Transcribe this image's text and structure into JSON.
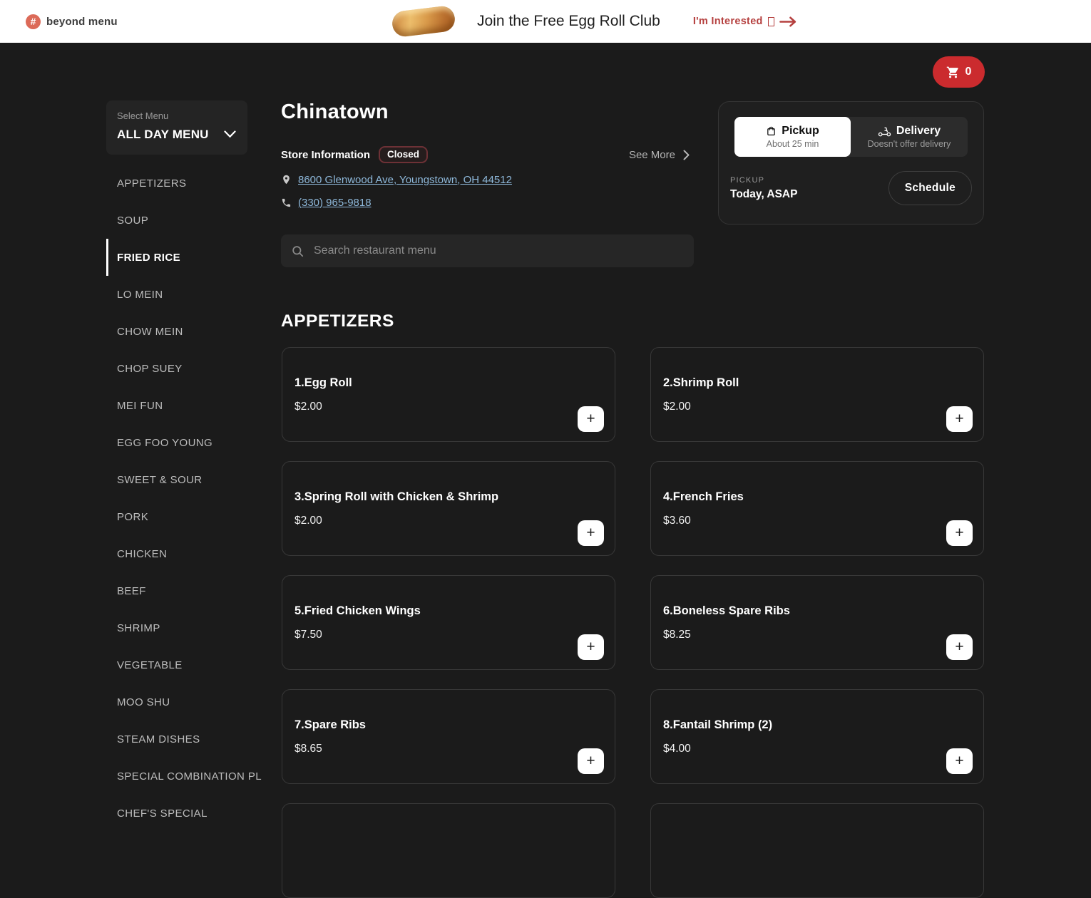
{
  "topbar": {
    "logo": "beyond menu",
    "promo_title": "Join the Free Egg Roll Club",
    "cta_label": "I'm Interested"
  },
  "cart": {
    "count": "0"
  },
  "sidebar": {
    "select_label": "Select Menu",
    "selected_menu": "ALL DAY MENU",
    "active_index": 2,
    "items": [
      "APPETIZERS",
      "SOUP",
      "FRIED RICE",
      "LO MEIN",
      "CHOW MEIN",
      "CHOP SUEY",
      "MEI FUN",
      "EGG FOO YOUNG",
      "SWEET & SOUR",
      "PORK",
      "CHICKEN",
      "BEEF",
      "SHRIMP",
      "VEGETABLE",
      "MOO SHU",
      "STEAM DISHES",
      "SPECIAL COMBINATION PL",
      "CHEF'S SPECIAL"
    ]
  },
  "store": {
    "name": "Chinatown",
    "info_label": "Store Information",
    "status_badge": "Closed",
    "see_more": "See More",
    "address": "8600 Glenwood Ave, Youngstown, OH 44512",
    "phone": "(330) 965-9818"
  },
  "search": {
    "placeholder": "Search restaurant menu"
  },
  "fulfillment": {
    "pickup_label": "Pickup",
    "pickup_sub": "About 25 min",
    "delivery_label": "Delivery",
    "delivery_sub": "Doesn't offer delivery",
    "pickup_caps": "PICKUP",
    "pickup_time": "Today, ASAP",
    "schedule_label": "Schedule"
  },
  "menu": {
    "section_title": "APPETIZERS",
    "add_label": "+",
    "partial_cards": 2,
    "items": [
      {
        "name": "1.Egg Roll",
        "price": "$2.00"
      },
      {
        "name": "2.Shrimp Roll",
        "price": "$2.00"
      },
      {
        "name": "3.Spring Roll with Chicken & Shrimp",
        "price": "$2.00"
      },
      {
        "name": "4.French Fries",
        "price": "$3.60"
      },
      {
        "name": "5.Fried Chicken Wings",
        "price": "$7.50"
      },
      {
        "name": "6.Boneless Spare Ribs",
        "price": "$8.25"
      },
      {
        "name": "7.Spare Ribs",
        "price": "$8.65"
      },
      {
        "name": "8.Fantail Shrimp (2)",
        "price": "$4.00"
      }
    ]
  },
  "colors": {
    "accent_red": "#cb2b2e",
    "cta_red": "#b5403f",
    "link_blue": "#8eb8da",
    "page_bg": "#1b1b1b",
    "topbar_bg": "#ffffff"
  }
}
